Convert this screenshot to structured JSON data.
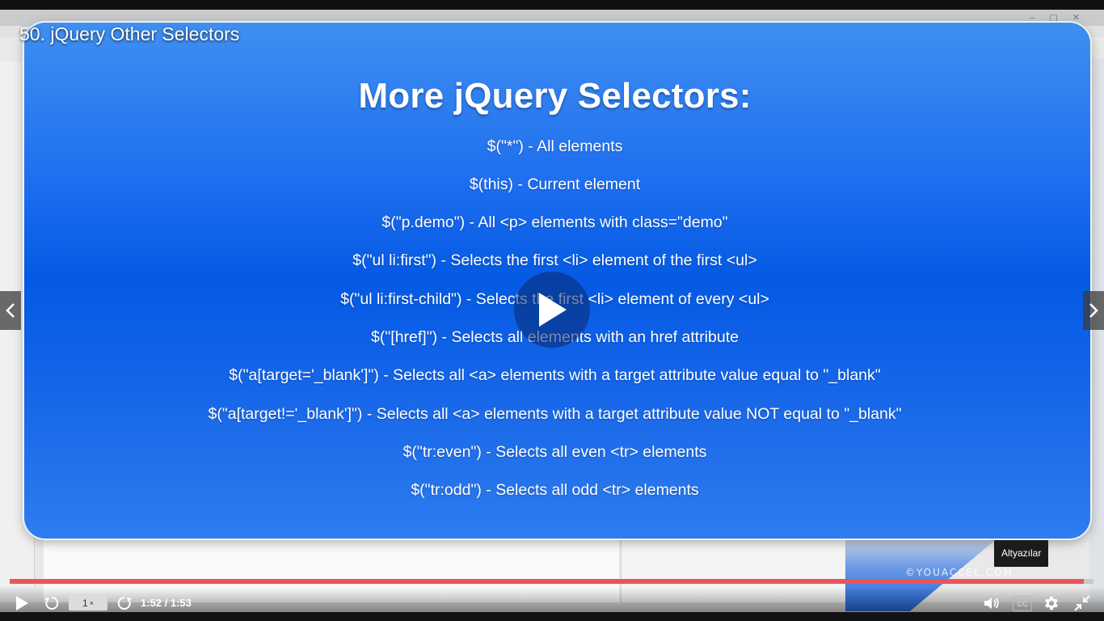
{
  "video": {
    "title": "50. jQuery Other Selectors",
    "current_time": "1:52",
    "duration": "1:53",
    "time_display": "1:52 / 1:53",
    "progress": 0.991,
    "speed_value": "1",
    "speed_suffix": "×"
  },
  "tooltip": {
    "captions": "Altyazılar"
  },
  "slide": {
    "title": "More jQuery Selectors:",
    "lines": [
      "$(\"*\") - All elements",
      "$(this) - Current element",
      "$(\"p.demo\") - All <p> elements with class=\"demo\"",
      "$(\"ul li:first\") - Selects the first <li> element of the first <ul>",
      "$(\"ul li:first-child\") - Selects the first <li> element of every <ul>",
      "$(\"[href]\") - Selects all elements with an href attribute",
      "$(\"a[target='_blank']\") - Selects all <a> elements with a target attribute value equal to \"_blank\"",
      "$(\"a[target!='_blank']\") - Selects all <a> elements with a target attribute value NOT equal to \"_blank\"",
      "$(\"tr:even\") - Selects all even <tr> elements",
      "$(\"tr:odd\") - Selects all odd <tr> elements"
    ],
    "watermark": "©YOUACCEL.COM"
  },
  "controls": {
    "cc_label": "CC"
  },
  "colors": {
    "progress_fill": "#e8565a",
    "progress_track": "#c9c9c9",
    "slide_blue": "#045ae4"
  },
  "icons": {
    "play": "play-icon",
    "rewind": "rewind-icon",
    "forward": "forward-icon",
    "volume": "volume-icon",
    "settings": "gear-icon",
    "exit_fullscreen": "exit-fullscreen-icon",
    "prev": "chevron-left-icon",
    "next": "chevron-right-icon"
  }
}
